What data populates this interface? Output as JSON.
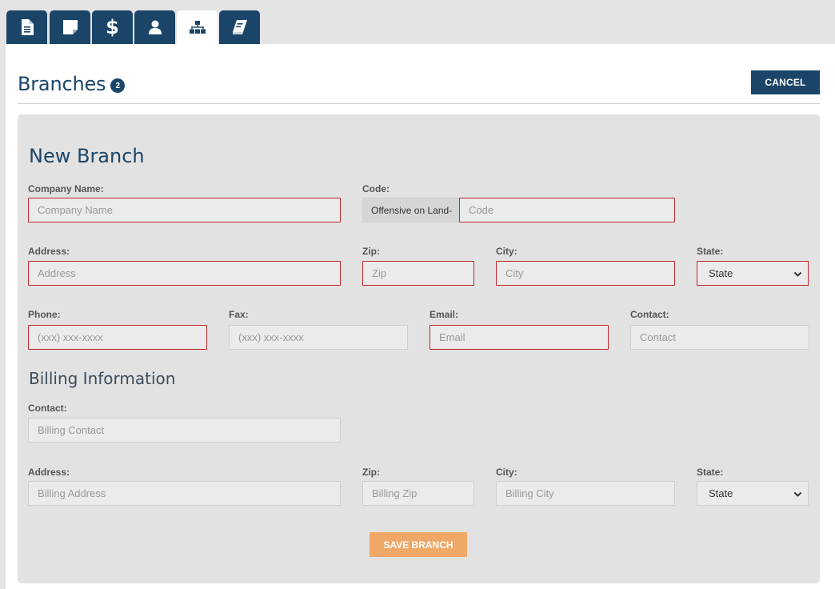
{
  "tabs": [
    {
      "name": "document",
      "icon": "document-icon",
      "active": false
    },
    {
      "name": "notes",
      "icon": "note-icon",
      "active": false
    },
    {
      "name": "billing",
      "icon": "dollar-icon",
      "glyph": "$",
      "active": false
    },
    {
      "name": "users",
      "icon": "user-icon",
      "active": false
    },
    {
      "name": "branches",
      "icon": "sitemap-icon",
      "active": true
    },
    {
      "name": "log",
      "icon": "notebook-icon",
      "active": false
    }
  ],
  "header": {
    "title": "Branches",
    "count": "2",
    "cancel_label": "CANCEL"
  },
  "form": {
    "title": "New Branch",
    "company_name": {
      "label": "Company Name:",
      "placeholder": "Company Name"
    },
    "code": {
      "label": "Code:",
      "prefix": "Offensive on Land-",
      "placeholder": "Code"
    },
    "address": {
      "label": "Address:",
      "placeholder": "Address"
    },
    "zip": {
      "label": "Zip:",
      "placeholder": "Zip"
    },
    "city": {
      "label": "City:",
      "placeholder": "City"
    },
    "state": {
      "label": "State:",
      "value": "State"
    },
    "phone": {
      "label": "Phone:",
      "placeholder": "(xxx) xxx-xxxx"
    },
    "fax": {
      "label": "Fax:",
      "placeholder": "(xxx) xxx-xxxx"
    },
    "email": {
      "label": "Email:",
      "placeholder": "Email"
    },
    "contact": {
      "label": "Contact:",
      "placeholder": "Contact"
    }
  },
  "billing": {
    "title": "Billing Information",
    "contact": {
      "label": "Contact:",
      "placeholder": "Billing Contact"
    },
    "address": {
      "label": "Address:",
      "placeholder": "Billing Address"
    },
    "zip": {
      "label": "Zip:",
      "placeholder": "Billing Zip"
    },
    "city": {
      "label": "City:",
      "placeholder": "Billing City"
    },
    "state": {
      "label": "State:",
      "value": "State"
    }
  },
  "save_label": "SAVE BRANCH",
  "colors": {
    "primary": "#1b4568",
    "required_border": "#c0272d",
    "save_button": "#f0a868",
    "form_background": "#e2e2e2"
  }
}
